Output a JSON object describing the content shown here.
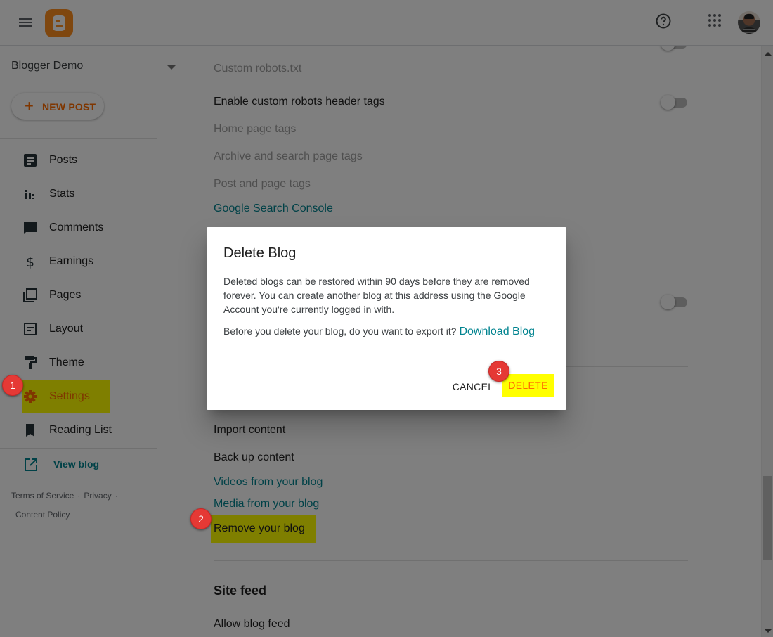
{
  "header": {
    "menu_icon": "hamburger-menu-icon",
    "logo_icon": "blogger-logo-icon",
    "help_icon": "help-circle-icon",
    "apps_icon": "apps-grid-icon",
    "avatar": "user-avatar"
  },
  "sidebar": {
    "blog_name": "Blogger Demo",
    "new_post_label": "NEW POST",
    "items": [
      {
        "label": "Posts",
        "icon": "posts-icon"
      },
      {
        "label": "Stats",
        "icon": "stats-icon"
      },
      {
        "label": "Comments",
        "icon": "comment-icon"
      },
      {
        "label": "Earnings",
        "icon": "dollar-icon"
      },
      {
        "label": "Pages",
        "icon": "pages-icon"
      },
      {
        "label": "Layout",
        "icon": "layout-icon"
      },
      {
        "label": "Theme",
        "icon": "paint-roller-icon"
      },
      {
        "label": "Settings",
        "icon": "gear-icon",
        "active": true
      },
      {
        "label": "Reading List",
        "icon": "bookmark-icon"
      }
    ],
    "view_blog_label": "View blog",
    "footer": {
      "terms": "Terms of Service",
      "privacy": "Privacy",
      "content_policy": "Content Policy",
      "separator": "·"
    }
  },
  "main": {
    "crawlers": {
      "custom_robots_txt": "Custom robots.txt",
      "enable_robots_header": "Enable custom robots header tags",
      "enable_robots_header_toggle": false,
      "home_page_tags": "Home page tags",
      "archive_tags": "Archive and search page tags",
      "post_tags": "Post and page tags",
      "search_console": "Google Search Console"
    },
    "hidden_toggle_on": false,
    "manage_blog": {
      "import": "Import content",
      "backup": "Back up content",
      "videos": "Videos from your blog",
      "media": "Media from your blog",
      "remove": "Remove your blog"
    },
    "site_feed": {
      "title": "Site feed",
      "allow_feed": "Allow blog feed"
    }
  },
  "dialog": {
    "title": "Delete Blog",
    "body": "Deleted blogs can be restored within 90 days before they are removed forever. You can create another blog at this address using the Google Account you're currently logged in with.",
    "export_prompt": "Before you delete your blog, do you want to export it?",
    "download_link": "Download Blog",
    "cancel_label": "CANCEL",
    "delete_label": "DELETE"
  },
  "annotations": {
    "step1": "1",
    "step2": "2",
    "step3": "3",
    "highlight_color": "#ffff00",
    "badge_color": "#e53935"
  },
  "colors": {
    "brand_orange": "#ff6d00",
    "link_teal": "#00838f"
  }
}
